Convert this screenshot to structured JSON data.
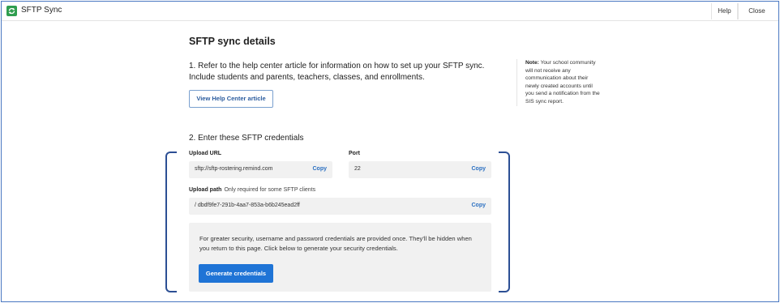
{
  "window": {
    "app_title": "SFTP Sync",
    "help_label": "Help",
    "close_label": "Close"
  },
  "page": {
    "title": "SFTP sync details",
    "step1_text": "1. Refer to the help center article for information on how to set up your SFTP sync. Include students and parents, teachers, classes, and enrollments.",
    "help_article_button": "View Help Center article",
    "step2_text": "2. Enter these SFTP credentials"
  },
  "side_note": {
    "label": "Note:",
    "text": " Your school community will not receive any communication about their newly created accounts until you send a notification from the SIS sync report."
  },
  "credentials": {
    "upload_url": {
      "label": "Upload URL",
      "value": "sftp://sftp-rostering.remind.com",
      "copy_label": "Copy"
    },
    "port": {
      "label": "Port",
      "value": "22",
      "copy_label": "Copy"
    },
    "upload_path": {
      "label": "Upload path",
      "hint": "Only required for some SFTP clients",
      "value": "/ dbdf9fe7-291b-4aa7-853a-b6b245ead2ff",
      "copy_label": "Copy"
    }
  },
  "security": {
    "text": "For greater security, username and password credentials are provided once. They'll be hidden when you return to this page. Click below to generate your security credentials.",
    "generate_button": "Generate credentials"
  },
  "colors": {
    "primary": "#1f74d6",
    "link": "#2a6fc1",
    "bracket": "#2c4f94",
    "logo": "#2f9e4f"
  }
}
